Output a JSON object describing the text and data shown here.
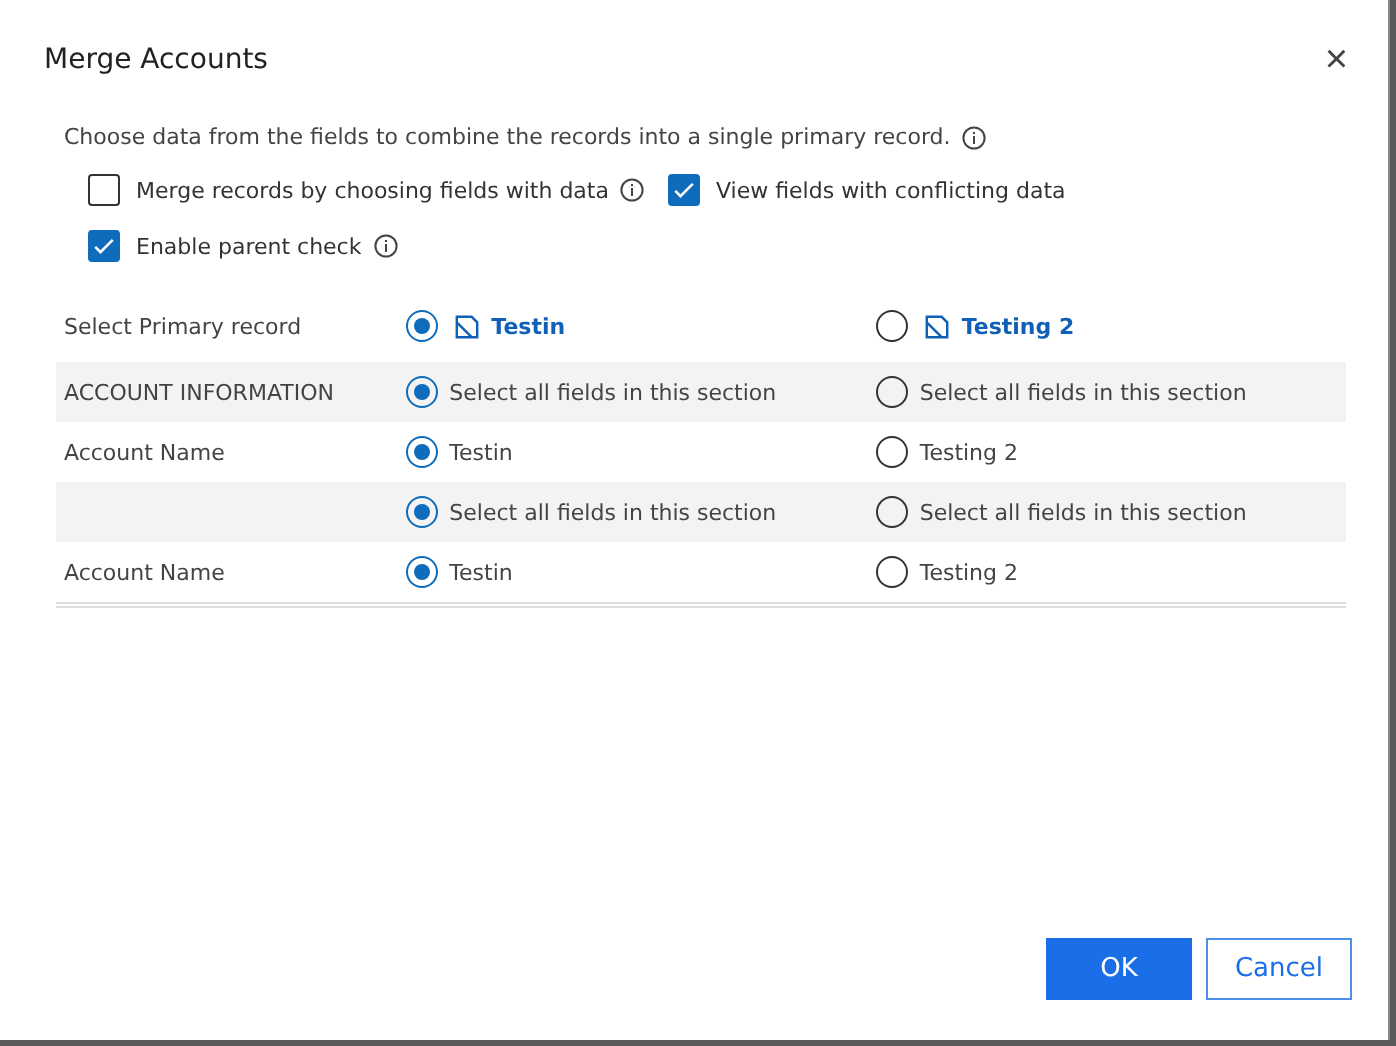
{
  "dialog": {
    "title": "Merge Accounts",
    "close": "×"
  },
  "description": "Choose data from the fields to combine the records into a single primary record.",
  "options": [
    {
      "label": "Merge records by choosing fields with data",
      "checked": false,
      "info": true
    },
    {
      "label": "View fields with conflicting data",
      "checked": true,
      "info": false
    },
    {
      "label": "Enable parent check",
      "checked": true,
      "info": true
    }
  ],
  "rows": [
    {
      "kind": "primary",
      "label": "Select Primary record",
      "choices": [
        {
          "text": "Testin",
          "selected": true
        },
        {
          "text": "Testing 2",
          "selected": false
        }
      ]
    },
    {
      "kind": "section",
      "label": "ACCOUNT INFORMATION",
      "choices": [
        {
          "text": "Select all fields in this section",
          "selected": true
        },
        {
          "text": "Select all fields in this section",
          "selected": false
        }
      ]
    },
    {
      "kind": "field",
      "label": "Account Name",
      "choices": [
        {
          "text": "Testin",
          "selected": true
        },
        {
          "text": "Testing 2",
          "selected": false
        }
      ]
    },
    {
      "kind": "section",
      "choices": [
        {
          "text": "Select all fields in this section",
          "selected": true
        },
        {
          "text": "Select all fields in this section",
          "selected": false
        }
      ]
    },
    {
      "kind": "field",
      "label": "Account Name",
      "choices": [
        {
          "text": "Testin",
          "selected": true
        },
        {
          "text": "Testing 2",
          "selected": false
        }
      ]
    }
  ],
  "buttons": [
    {
      "label": "OK",
      "kind": "primary"
    },
    {
      "label": "Cancel",
      "kind": "secondary"
    }
  ]
}
